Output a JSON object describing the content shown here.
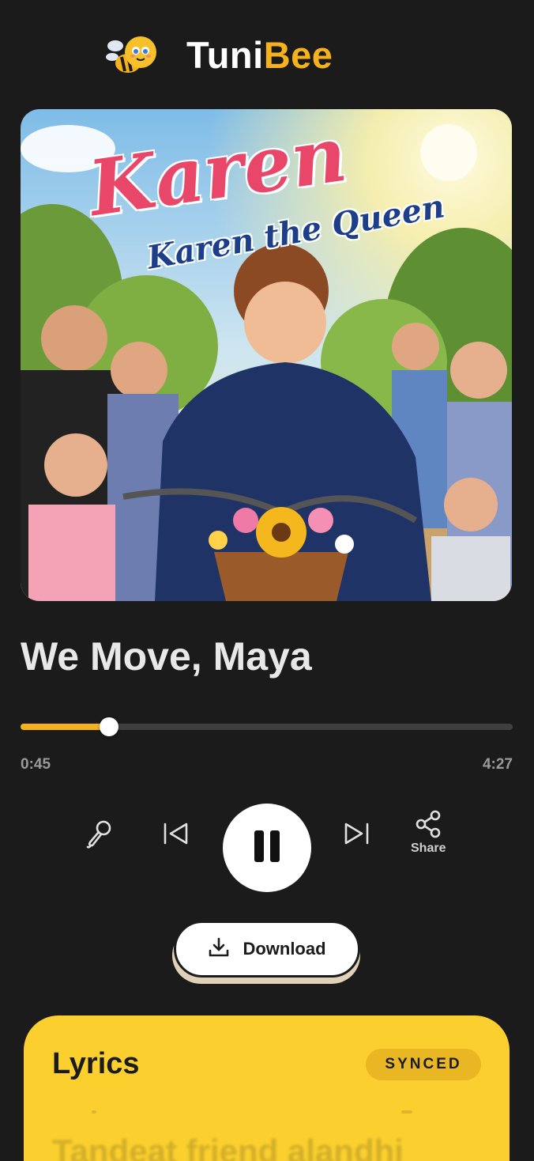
{
  "header": {
    "brand_part1": "Tuni",
    "brand_part2": "Bee",
    "logo_icon": "bee-mascot-icon"
  },
  "artwork": {
    "title_text": "Karen",
    "subtitle_text": "Karen the Queen"
  },
  "player": {
    "song_title": "We Move, Maya",
    "elapsed": "0:45",
    "total": "4:27",
    "progress_fraction": 0.18
  },
  "controls": {
    "mic_icon": "microphone-icon",
    "prev_icon": "skip-previous-icon",
    "play_icon": "pause-icon",
    "next_icon": "skip-next-icon",
    "share_icon": "share-icon",
    "share_label": "Share"
  },
  "download": {
    "label": "Download",
    "icon": "download-icon"
  },
  "lyrics": {
    "title": "Lyrics",
    "badge": "SYNCED",
    "visible_line": "Tandeat friend alandhi"
  },
  "colors": {
    "background": "#1b1b1b",
    "accent": "#f5b21c",
    "lyrics_card": "#fbd02e"
  }
}
